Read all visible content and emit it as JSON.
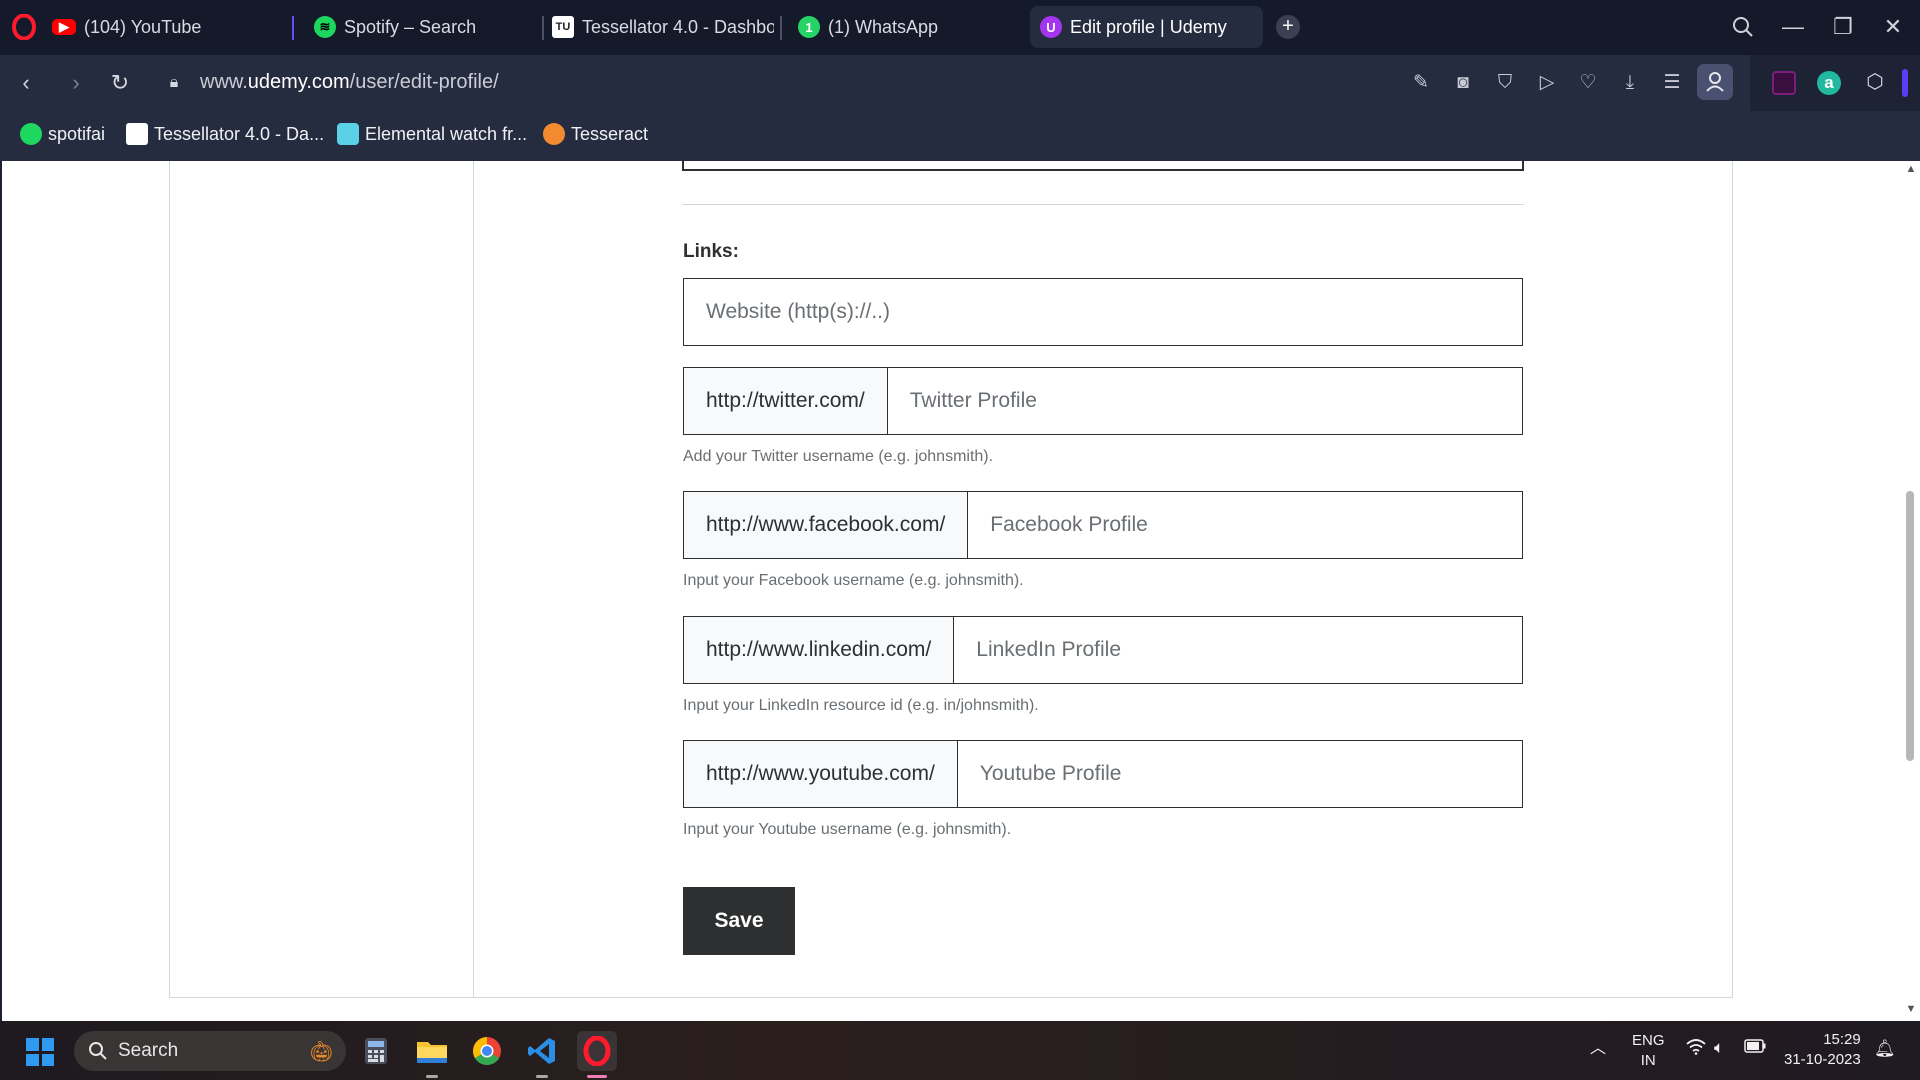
{
  "browser": {
    "tabs": [
      {
        "title": "(104) YouTube",
        "icon": "youtube-icon",
        "color": "#ff0000"
      },
      {
        "title": "Spotify – Search",
        "icon": "spotify-icon",
        "color": "#1ed760"
      },
      {
        "title": "Tessellator 4.0 - Dashbo",
        "icon": "tessellator-icon",
        "color": "#ffffff"
      },
      {
        "title": "(1) WhatsApp",
        "icon": "whatsapp-icon",
        "color": "#25d366"
      },
      {
        "title": "Edit profile | Udemy",
        "icon": "udemy-icon",
        "color": "#a435f0",
        "active": true
      }
    ],
    "url_prefix": "www.",
    "url_domain": "udemy.com",
    "url_path": "/user/edit-profile/",
    "bookmarks": [
      {
        "label": "spotifai",
        "icon": "spotify-icon",
        "color": "#1ed760"
      },
      {
        "label": "Tessellator 4.0 - Da...",
        "icon": "tessellator-icon",
        "color": "#ffffff"
      },
      {
        "label": "Elemental watch fr...",
        "icon": "watch-icon",
        "color": "#5ad1e6"
      },
      {
        "label": "Tesseract",
        "icon": "tesseract-icon",
        "color": "#f28b30"
      }
    ]
  },
  "form": {
    "links_label": "Links:",
    "website": {
      "placeholder": "Website (http(s)://..)"
    },
    "twitter": {
      "prefix": "http://twitter.com/",
      "placeholder": "Twitter Profile",
      "hint": "Add your Twitter username (e.g. johnsmith)."
    },
    "facebook": {
      "prefix": "http://www.facebook.com/",
      "placeholder": "Facebook Profile",
      "hint": "Input your Facebook username (e.g. johnsmith)."
    },
    "linkedin": {
      "prefix": "http://www.linkedin.com/",
      "placeholder": "LinkedIn Profile",
      "hint": "Input your LinkedIn resource id (e.g. in/johnsmith)."
    },
    "youtube": {
      "prefix": "http://www.youtube.com/",
      "placeholder": "Youtube Profile",
      "hint": "Input your Youtube username (e.g. johnsmith)."
    },
    "save_label": "Save"
  },
  "taskbar": {
    "search_label": "Search",
    "lang_line1": "ENG",
    "lang_line2": "IN",
    "time": "15:29",
    "date": "31-10-2023"
  },
  "colors": {
    "udemy_purple": "#a435f0",
    "button_dark": "#2d2f31",
    "browser_bg": "#262c40"
  }
}
